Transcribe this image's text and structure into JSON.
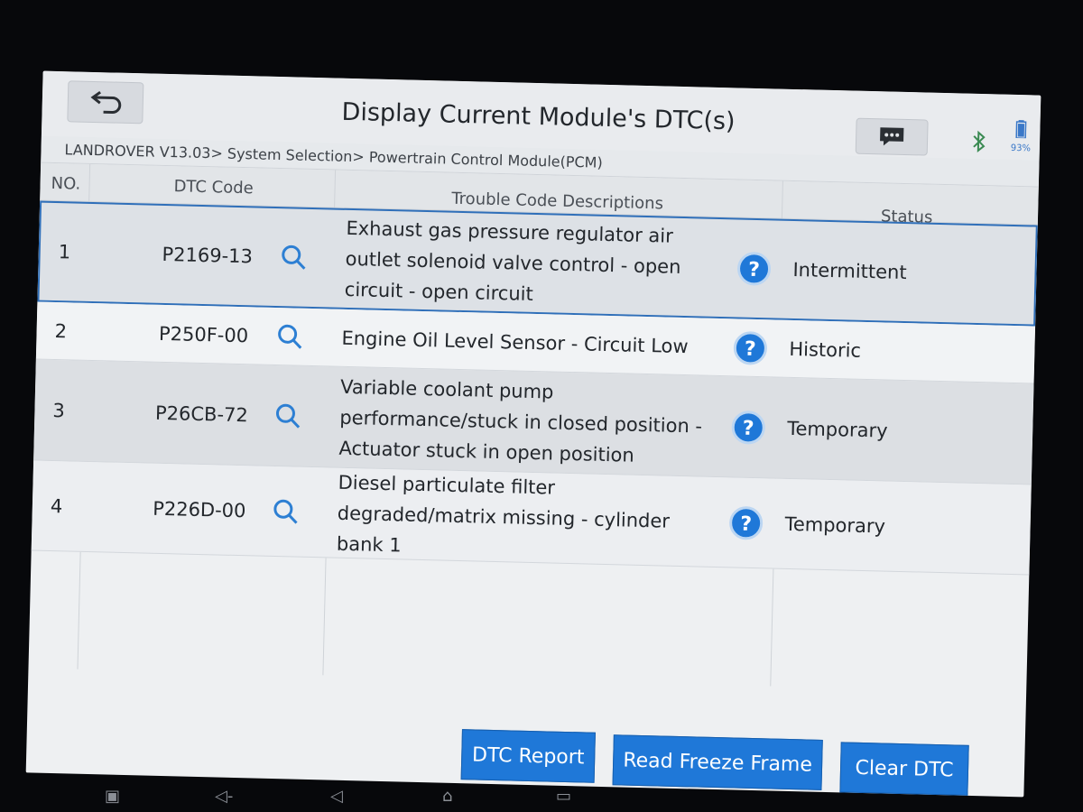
{
  "header": {
    "title": "Display Current Module's DTC(s)",
    "battery_level": "93%"
  },
  "breadcrumb": "LANDROVER V13.03> System Selection> Powertrain Control Module(PCM)",
  "table": {
    "columns": [
      "NO.",
      "DTC Code",
      "Trouble Code Descriptions",
      "Status"
    ],
    "rows": [
      {
        "no": "1",
        "code": "P2169-13",
        "desc": "Exhaust gas pressure regulator air outlet solenoid valve control - open circuit - open circuit",
        "status": "Intermittent"
      },
      {
        "no": "2",
        "code": "P250F-00",
        "desc": "Engine Oil Level Sensor - Circuit Low",
        "status": "Historic"
      },
      {
        "no": "3",
        "code": "P26CB-72",
        "desc": "Variable coolant pump performance/stuck in closed position - Actuator stuck in open position",
        "status": "Temporary"
      },
      {
        "no": "4",
        "code": "P226D-00",
        "desc": "Diesel particulate filter degraded/matrix missing - cylinder bank 1",
        "status": "Temporary"
      }
    ]
  },
  "buttons": {
    "report": "DTC Report",
    "freeze": "Read Freeze Frame",
    "clear": "Clear DTC"
  },
  "icons": {
    "back": "back-arrow-icon",
    "message": "chat-icon",
    "bluetooth": "bluetooth-icon",
    "search": "search-icon",
    "help": "help-icon"
  },
  "colors": {
    "accent": "#1f78d8",
    "selected_border": "#2f6fb9"
  }
}
